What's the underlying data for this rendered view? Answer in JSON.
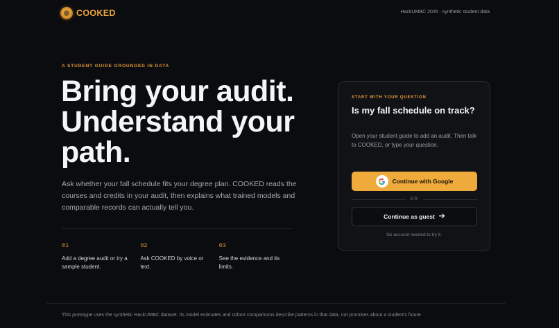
{
  "header": {
    "logo_text": "COOKED",
    "meta": "HackUMBC 2026 · synthetic student data"
  },
  "hero": {
    "eyebrow": "A STUDENT GUIDE GROUNDED IN DATA",
    "headline": "Bring your audit. Understand your path.",
    "lede": "Ask whether your fall schedule fits your degree plan. COOKED reads the courses and credits in your audit, then explains what trained models and comparable records can actually tell you."
  },
  "steps": [
    {
      "num": "01",
      "text": "Add a degree audit or try a sample student."
    },
    {
      "num": "02",
      "text": "Ask COOKED by voice or text."
    },
    {
      "num": "03",
      "text": "See the evidence and its limits."
    }
  ],
  "card": {
    "eyebrow": "START WITH YOUR QUESTION",
    "title": "Is my fall schedule on track?",
    "description": "Open your student guide to add an audit. Then talk to COOKED, or type your question.",
    "google_label": "Continue with Google",
    "or_label": "OR",
    "guest_label": "Continue as guest",
    "note": "No account needed to try it."
  },
  "footer": {
    "text": "This prototype uses the synthetic HackUMBC dataset. Its model estimates and cohort comparisons describe patterns in that data, not promises about a student's future."
  },
  "colors": {
    "accent": "#eeaa3a",
    "background": "#0b0c0f",
    "card": "#111216"
  },
  "icons": {
    "logo": "chef-logo-icon",
    "google": "google-g-icon",
    "arrow": "arrow-right-icon"
  }
}
